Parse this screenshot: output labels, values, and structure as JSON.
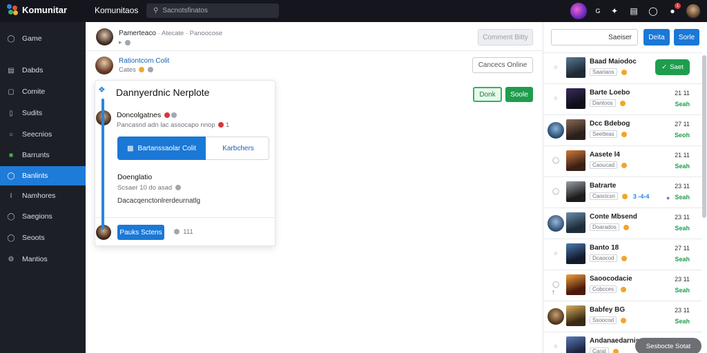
{
  "topbar": {
    "brand": "Komunitar",
    "title": "Komunitaos",
    "search_placeholder": "Sacnotsfinatos",
    "icon_label_g": "G"
  },
  "sidebar": {
    "items": [
      {
        "label": "Game",
        "icon": "shield-icon"
      },
      {
        "label": "Dabds",
        "icon": "bars-icon"
      },
      {
        "label": "Comite",
        "icon": "square-icon"
      },
      {
        "label": "Sudits",
        "icon": "page-icon"
      },
      {
        "label": "Seecnios",
        "icon": "chat-icon"
      },
      {
        "label": "Barrunts",
        "icon": "box-icon"
      },
      {
        "label": "Banlints",
        "icon": "chat-icon"
      },
      {
        "label": "Namhores",
        "icon": "i-icon"
      },
      {
        "label": "Saegions",
        "icon": "shield-icon"
      },
      {
        "label": "Seoots",
        "icon": "ring-icon"
      },
      {
        "label": "Mantios",
        "icon": "gear-icon"
      }
    ],
    "active_index": 6
  },
  "main": {
    "row1": {
      "title": "Pamerteaco",
      "meta": "· Atecate · Panoocose",
      "button": "Comment Bitty"
    },
    "row2": {
      "title": "Rationtcom Colit",
      "sub": "Cates",
      "button": "Cancecs Online"
    },
    "actions": {
      "green_outline": "Donk",
      "green": "Soole"
    },
    "card": {
      "title": "Dannyerdnic Nerplote",
      "user": "Doncolgatnes",
      "meta": "Pancasnd adn lac assocapo nnop",
      "meta_count": "1",
      "btn_primary": "Bartanssaolar Colit",
      "btn_secondary": "Karbchers",
      "section_title": "Doenglatio",
      "section_meta": "Scsaer 10 do asad",
      "section_body": "Dacacqenctonlrerdeurnatlg",
      "footer_button": "Pauks Sctens",
      "footer_meta": "111"
    }
  },
  "right": {
    "input_label": "Saeiser",
    "btn1": "Deita",
    "btn2": "Sorle",
    "items": [
      {
        "title": "Baad Maiodoc",
        "tag": "Saariaos",
        "time": "",
        "status": "Saet",
        "badge": true
      },
      {
        "title": "Barte Loebo",
        "tag": "Dantoos",
        "time": "21 11",
        "status": "Seah"
      },
      {
        "title": "Dcc Bdebog",
        "tag": "Seetteas",
        "time": "27 11",
        "status": "Seoh"
      },
      {
        "title": "Aasete l4",
        "tag": "Caoucad",
        "time": "21 11",
        "status": "Seah"
      },
      {
        "title": "Batrarte",
        "tag": "Caocicsn",
        "time": "23 11",
        "status": "Seah",
        "extra": "3 -4-4"
      },
      {
        "title": "Conte Mbsend",
        "tag": "Doarados",
        "time": "23 11",
        "status": "Seah"
      },
      {
        "title": "Banto 18",
        "tag": "Dcaocod",
        "time": "27 11",
        "status": "Seah"
      },
      {
        "title": "Saoocodacie",
        "tag": "Cobcces",
        "time": "23 11",
        "status": "Seah"
      },
      {
        "title": "Babfey BG",
        "tag": "Ssoocod",
        "time": "23 11",
        "status": "Seah"
      },
      {
        "title": "Andanaedarnis",
        "tag": "Carat",
        "time": "",
        "status": ""
      }
    ],
    "toast": "Sesbocte Sotat"
  }
}
